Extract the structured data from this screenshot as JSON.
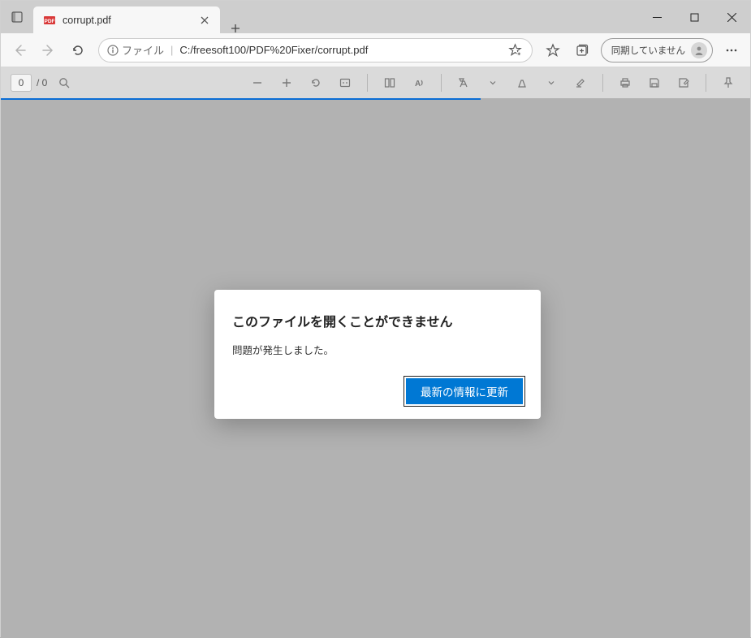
{
  "tab": {
    "title": "corrupt.pdf"
  },
  "address": {
    "protocol_label": "ファイル",
    "path": "C:/freesoft100/PDF%20Fixer/corrupt.pdf"
  },
  "sync": {
    "label": "同期していません"
  },
  "pdf_toolbar": {
    "page_current": "0",
    "page_total": "/ 0"
  },
  "dialog": {
    "title": "このファイルを開くことができません",
    "message": "問題が発生しました。",
    "button_label": "最新の情報に更新"
  }
}
